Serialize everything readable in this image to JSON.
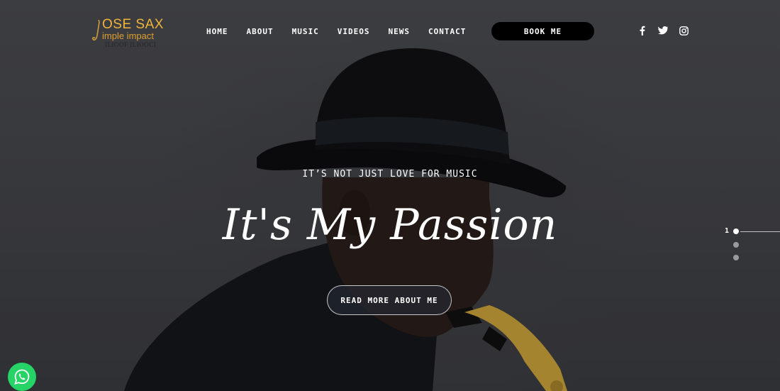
{
  "logo": {
    "line1": "OSE SAX",
    "line2": "imple impact",
    "line3": "ILIOOF ILIOOCI"
  },
  "nav": {
    "home": "HOME",
    "about": "ABOUT",
    "music": "MUSIC",
    "videos": "VIDEOS",
    "news": "NEWS",
    "contact": "CONTACT",
    "book": "BOOK ME"
  },
  "social": [
    "facebook-icon",
    "twitter-icon",
    "instagram-icon"
  ],
  "hero": {
    "tagline": "IT’S NOT JUST LOVE FOR MUSIC",
    "headline": "It's My Passion",
    "cta": "READ MORE ABOUT ME"
  },
  "slider": {
    "current": "1",
    "total_slides": 3
  },
  "colors": {
    "accent": "#f0b43a",
    "whatsapp": "#25d366",
    "button": "#000000"
  }
}
